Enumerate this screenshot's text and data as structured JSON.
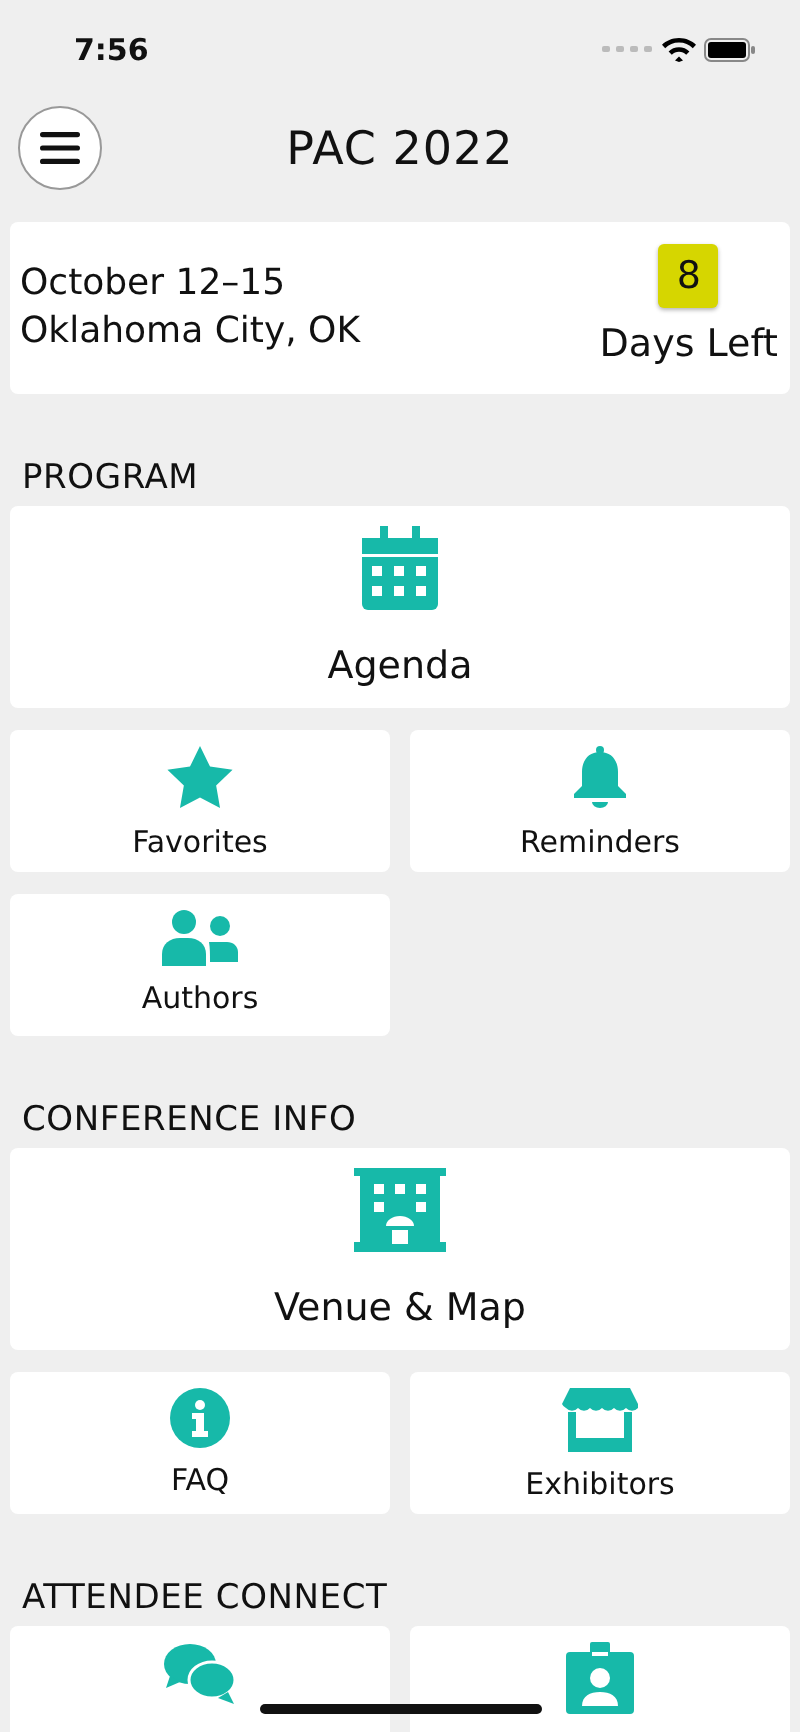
{
  "status_bar": {
    "time": "7:56"
  },
  "header": {
    "title": "PAC 2022"
  },
  "info_card": {
    "dates": "October 12–15",
    "location": "Oklahoma City, OK",
    "days_count": "8",
    "days_label": "Days Left"
  },
  "sections": [
    {
      "title": "PROGRAM",
      "tiles": [
        {
          "kind": "wide",
          "label": "Agenda"
        },
        {
          "kind": "half",
          "label": "Favorites"
        },
        {
          "kind": "half",
          "label": "Reminders"
        },
        {
          "kind": "half",
          "label": "Authors"
        }
      ]
    },
    {
      "title": "CONFERENCE INFO",
      "tiles": [
        {
          "kind": "wide",
          "label": "Venue & Map"
        },
        {
          "kind": "half",
          "label": "FAQ"
        },
        {
          "kind": "half",
          "label": "Exhibitors"
        }
      ]
    },
    {
      "title": "ATTENDEE CONNECT",
      "tiles": [
        {
          "kind": "half"
        },
        {
          "kind": "half"
        }
      ]
    }
  ]
}
